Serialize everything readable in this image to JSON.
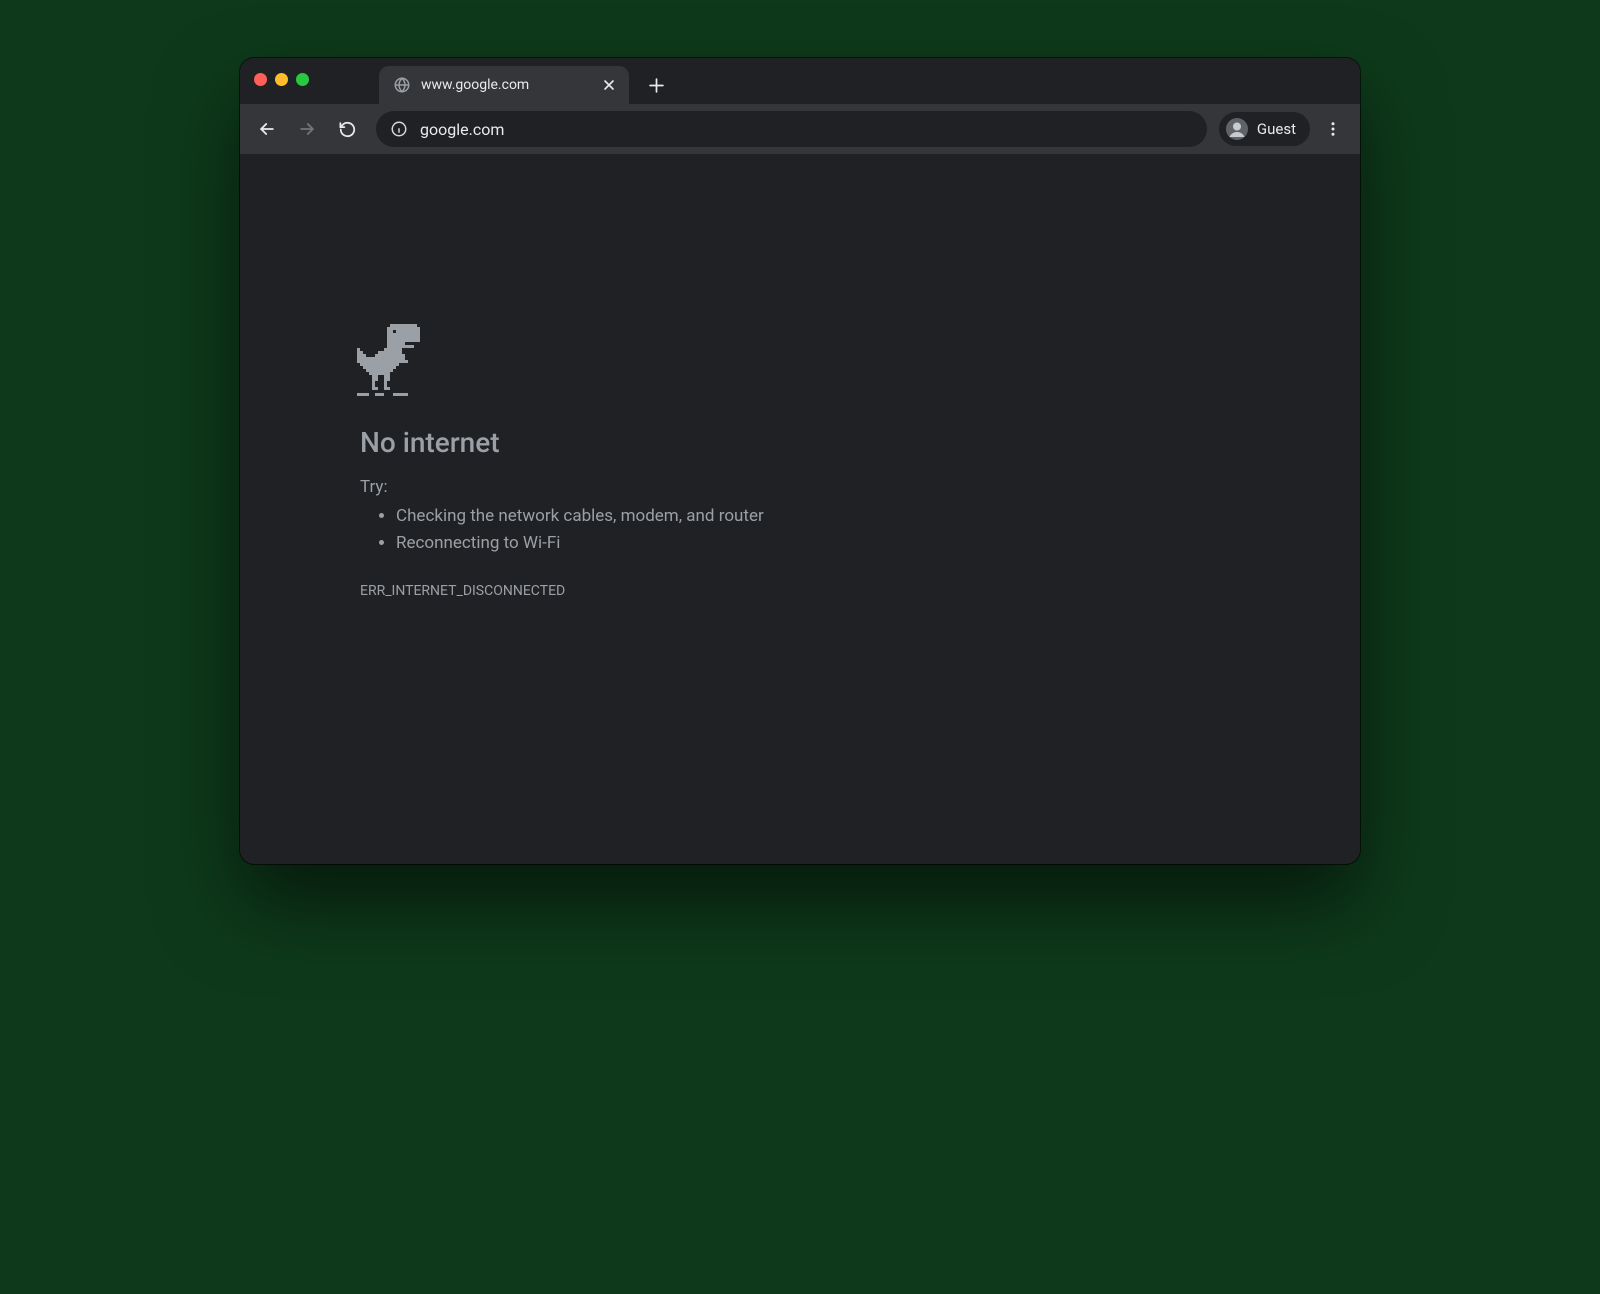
{
  "tab": {
    "title": "www.google.com"
  },
  "omnibox": {
    "url": "google.com"
  },
  "profile": {
    "label": "Guest"
  },
  "error": {
    "heading": "No internet",
    "try_label": "Try:",
    "suggestions": [
      "Checking the network cables, modem, and router",
      "Reconnecting to Wi-Fi"
    ],
    "code": "ERR_INTERNET_DISCONNECTED"
  }
}
